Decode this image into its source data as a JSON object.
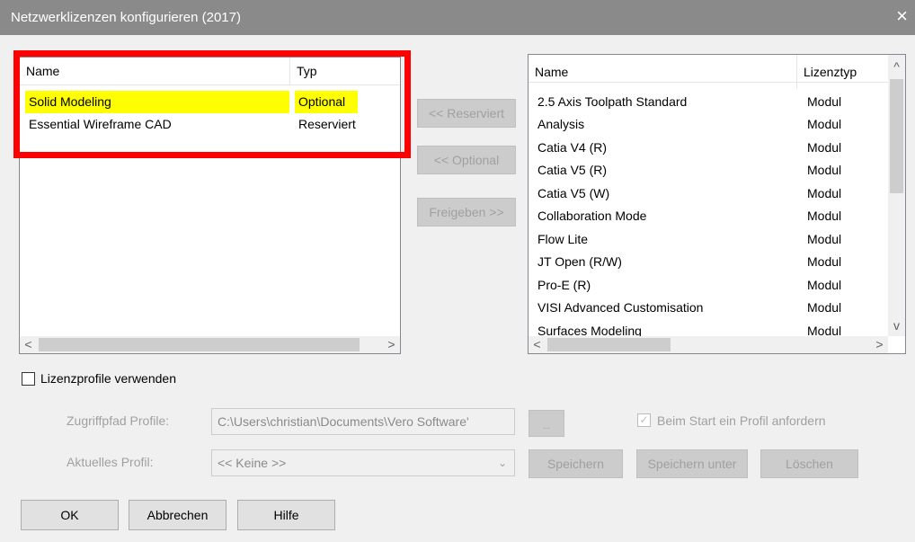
{
  "window": {
    "title": "Netzwerklizenzen konfigurieren (2017)",
    "close_glyph": "×"
  },
  "left_list": {
    "columns": [
      "Name",
      "Typ"
    ],
    "rows": [
      {
        "name": "Solid Modeling",
        "type": "Optional",
        "highlighted": true
      },
      {
        "name": "Essential Wireframe CAD",
        "type": "Reserviert",
        "highlighted": false
      }
    ]
  },
  "middle_buttons": {
    "reserve": "<< Reserviert",
    "optional": "<< Optional",
    "release": "Freigeben >>"
  },
  "right_list": {
    "columns": [
      "Name",
      "Lizenztyp"
    ],
    "rows": [
      {
        "name": "2.5 Axis Toolpath Standard",
        "type": "Modul"
      },
      {
        "name": "Analysis",
        "type": "Modul"
      },
      {
        "name": "Catia V4 (R)",
        "type": "Modul"
      },
      {
        "name": "Catia V5 (R)",
        "type": "Modul"
      },
      {
        "name": "Catia V5 (W)",
        "type": "Modul"
      },
      {
        "name": "Collaboration Mode",
        "type": "Modul"
      },
      {
        "name": "Flow Lite",
        "type": "Modul"
      },
      {
        "name": "JT Open (R/W)",
        "type": "Modul"
      },
      {
        "name": "Pro-E (R)",
        "type": "Modul"
      },
      {
        "name": "VISI Advanced Customisation",
        "type": "Modul"
      },
      {
        "name": "Surfaces Modeling",
        "type": "Modul"
      }
    ]
  },
  "scroll": {
    "left": "<",
    "right": ">",
    "up": "^",
    "down": "v"
  },
  "profiles": {
    "use_profiles_label": "Lizenzprofile verwenden",
    "access_path_label": "Zugriffpfad Profile:",
    "access_path_value": "C:\\Users\\christian\\Documents\\Vero Software'",
    "browse_label": "...",
    "request_on_start_label": "Beim Start ein Profil anfordern",
    "current_profile_label": "Aktuelles Profil:",
    "current_profile_value": "<< Keine >>",
    "save_label": "Speichern",
    "save_as_label": "Speichern unter",
    "delete_label": "Löschen"
  },
  "footer": {
    "ok": "OK",
    "cancel": "Abbrechen",
    "help": "Hilfe"
  },
  "colors": {
    "highlight": "#ffff00",
    "annotation": "#ff0000",
    "titlebar": "#8a8a8a"
  }
}
